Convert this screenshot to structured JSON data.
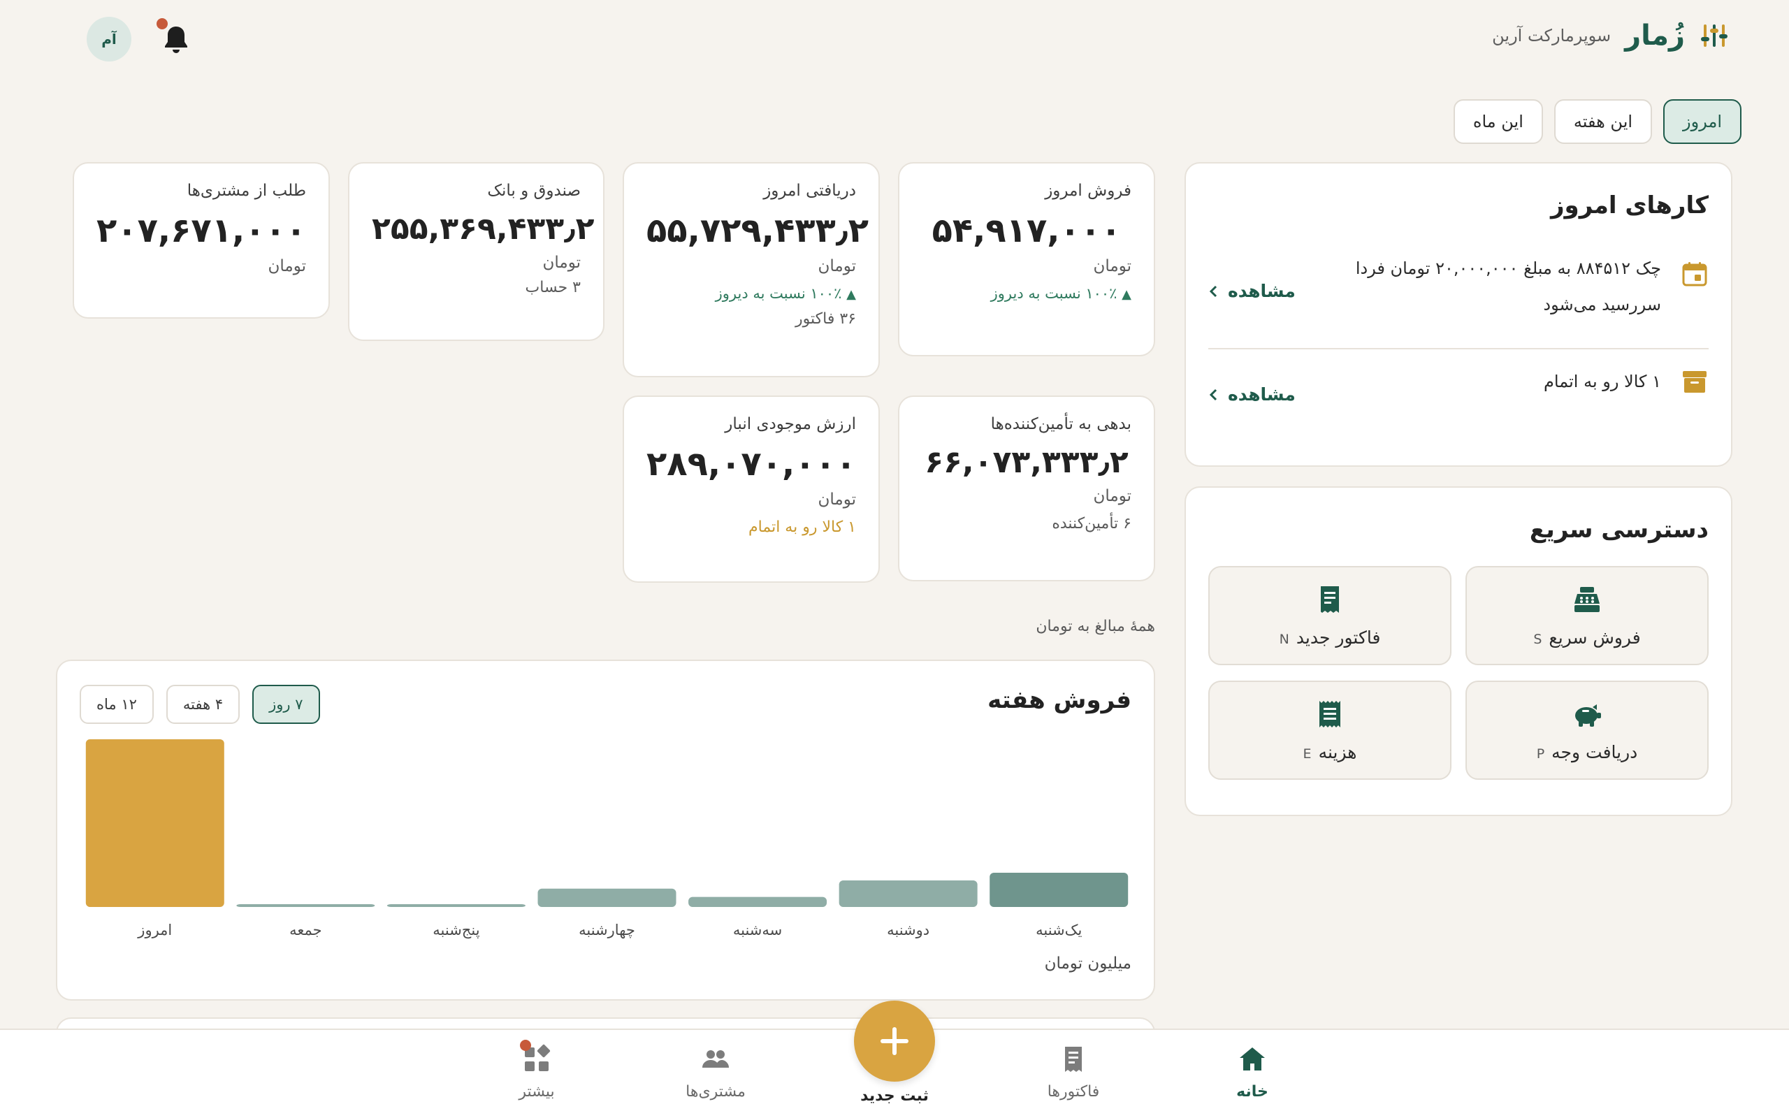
{
  "header": {
    "brand_name": "زُمار",
    "store_name": "سوپرمارکت آرین",
    "avatar_initials": "آم"
  },
  "period_tabs": [
    "امروز",
    "این هفته",
    "این ماه"
  ],
  "kpis": {
    "sales_today": {
      "title": "فروش امروز",
      "value": "۵۴,۹۱۷,۰۰۰",
      "unit": "تومان",
      "trend": "۱۰۰٪ نسبت به دیروز"
    },
    "received_today": {
      "title": "دریافتی امروز",
      "value": "۵۵,۷۲۹,۴۳۳٫۲",
      "unit": "تومان",
      "trend": "۱۰۰٪ نسبت به دیروز",
      "sub": "۳۶ فاکتور"
    },
    "cash_bank": {
      "title": "صندوق و بانک",
      "value": "۲۵۵,۳۶۹,۴۳۳٫۲",
      "unit": "تومان",
      "sub": "۳ حساب"
    },
    "receivables": {
      "title": "طلب از مشتری‌ها",
      "value": "۲۰۷,۶۷۱,۰۰۰",
      "unit": "تومان"
    },
    "payables": {
      "title": "بدهی به تأمین‌کننده‌ها",
      "value": "۶۶,۰۷۳,۳۳۳٫۲",
      "unit": "تومان",
      "sub": "۶ تأمین‌کننده"
    },
    "inventory": {
      "title": "ارزش موجودی انبار",
      "value": "۲۸۹,۰۷۰,۰۰۰",
      "unit": "تومان",
      "warning": "۱ کالا رو به اتمام"
    }
  },
  "amount_note": "همهٔ مبالغ به تومان",
  "chart": {
    "title": "فروش هفته",
    "range_tabs": [
      "۷ روز",
      "۴ هفته",
      "۱۲ ماه"
    ],
    "unit_label": "میلیون تومان"
  },
  "chart_data": {
    "type": "bar",
    "categories": [
      "یک‌شنبه",
      "دوشنبه",
      "سه‌شنبه",
      "چهارشنبه",
      "پنج‌شنبه",
      "جمعه",
      "امروز"
    ],
    "values": [
      11.2,
      8.7,
      3.3,
      6.0,
      0.4,
      0.4,
      54.9
    ],
    "ylabel": "میلیون تومان",
    "ylim": [
      0,
      54.9
    ],
    "highlight_category": "امروز",
    "colors": {
      "normal": "#8FADA6",
      "first": "#6F958D",
      "highlight": "#D9A441"
    }
  },
  "tasks": {
    "title": "کارهای امروز",
    "items": [
      {
        "icon": "calendar-icon",
        "text": "چک ۸۸۴۵۱۲ به مبلغ ۲۰,۰۰۰,۰۰۰ تومان فردا سررسید می‌شود",
        "link": "مشاهده"
      },
      {
        "icon": "archive-box-icon",
        "text": "۱ کالا رو به اتمام",
        "link": "مشاهده"
      }
    ]
  },
  "quick_access": {
    "title": "دسترسی سریع",
    "buttons": [
      {
        "label": "فروش سریع",
        "key": "S",
        "icon": "cash-register-icon"
      },
      {
        "label": "فاکتور جدید",
        "key": "N",
        "icon": "invoice-icon"
      },
      {
        "label": "دریافت وجه",
        "key": "P",
        "icon": "piggy-bank-icon"
      },
      {
        "label": "هزینه",
        "key": "E",
        "icon": "receipt-icon"
      }
    ]
  },
  "bottom_nav": {
    "home": "خانه",
    "invoices": "فاکتورها",
    "new_entry": "ثبت جدید",
    "customers": "مشتری‌ها",
    "more": "بیشتر"
  },
  "colors": {
    "brand_green": "#1F5B4B",
    "accent_gold": "#D9A441",
    "trend_green": "#2F7A5E",
    "alert_red": "#C75A3A"
  }
}
